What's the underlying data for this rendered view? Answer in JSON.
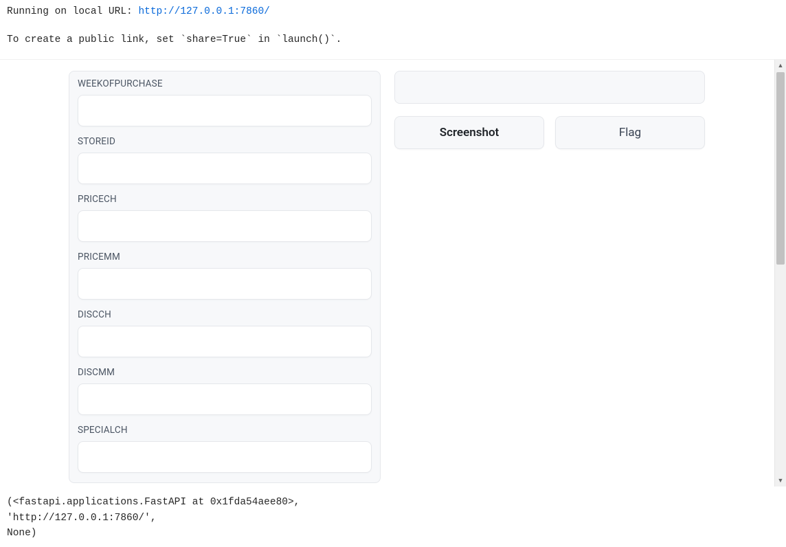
{
  "console": {
    "running_prefix": "Running on local URL:  ",
    "url": "http://127.0.0.1:7860/",
    "share_hint_prefix": "To create a public link, set ",
    "share_hint_code1": "`share=True`",
    "share_hint_mid": " in ",
    "share_hint_code2": "`launch()`",
    "share_hint_suffix": "."
  },
  "form": {
    "fields": [
      {
        "label": "WEEKOFPURCHASE",
        "value": ""
      },
      {
        "label": "STOREID",
        "value": ""
      },
      {
        "label": "PRICECH",
        "value": ""
      },
      {
        "label": "PRICEMM",
        "value": ""
      },
      {
        "label": "DISCCH",
        "value": ""
      },
      {
        "label": "DISCMM",
        "value": ""
      },
      {
        "label": "SPECIALCH",
        "value": ""
      }
    ]
  },
  "buttons": {
    "screenshot": "Screenshot",
    "flag": "Flag"
  },
  "output_tuple": {
    "line1": "(<fastapi.applications.FastAPI at 0x1fda54aee80>,",
    "line2": " 'http://127.0.0.1:7860/',",
    "line3": " None)"
  }
}
